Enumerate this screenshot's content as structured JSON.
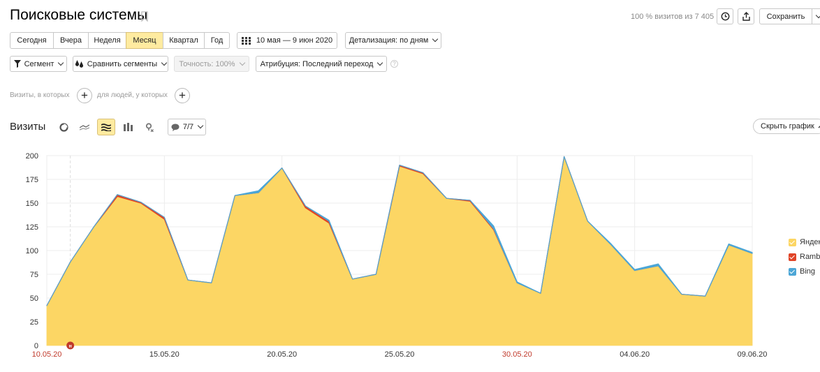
{
  "header": {
    "title": "Поисковые системы",
    "visits_info": "100 % визитов из 7 405",
    "save_label": "Сохранить"
  },
  "periods": [
    "Сегодня",
    "Вчера",
    "Неделя",
    "Месяц",
    "Квартал",
    "Год"
  ],
  "active_period": "Месяц",
  "date_range": "10 мая — 9 июн 2020",
  "detail": "Детализация: по дням",
  "filters": {
    "segment": "Сегмент",
    "compare": "Сравнить сегменты",
    "accuracy": "Точность: 100%",
    "attribution": "Атрибуция: Последний переход"
  },
  "conditions": {
    "visits_label": "Визиты, в которых",
    "people_label": "для людей, у которых"
  },
  "chart_section": {
    "title": "Визиты",
    "notes_label": "7/7",
    "hide_label": "Скрыть график"
  },
  "colors": {
    "yandex": "#fcd664",
    "rambler": "#e04427",
    "bing": "#4ca6d6",
    "active_bg": "#ffeba0",
    "holiday_red": "#c0392b"
  },
  "chart_data": {
    "type": "area",
    "stacked": true,
    "x": [
      "10.05.20",
      "11.05.20",
      "12.05.20",
      "13.05.20",
      "14.05.20",
      "15.05.20",
      "16.05.20",
      "17.05.20",
      "18.05.20",
      "19.05.20",
      "20.05.20",
      "21.05.20",
      "22.05.20",
      "23.05.20",
      "24.05.20",
      "25.05.20",
      "26.05.20",
      "27.05.20",
      "28.05.20",
      "29.05.20",
      "30.05.20",
      "31.05.20",
      "01.06.20",
      "02.06.20",
      "03.06.20",
      "04.06.20",
      "05.06.20",
      "06.06.20",
      "07.06.20",
      "08.06.20",
      "09.06.20"
    ],
    "x_tick_labels": [
      "10.05.20",
      "15.05.20",
      "20.05.20",
      "25.05.20",
      "30.05.20",
      "04.06.20",
      "09.06.20"
    ],
    "red_tick_labels": [
      "10.05.20",
      "30.05.20"
    ],
    "ylim": [
      0,
      200
    ],
    "yticks": [
      0,
      25,
      50,
      75,
      100,
      125,
      150,
      175,
      200
    ],
    "grid": true,
    "legend": "right",
    "annotation": "н",
    "series": [
      {
        "name": "Яндекс",
        "values": [
          42,
          88,
          125,
          157,
          150,
          133,
          69,
          66,
          158,
          161,
          187,
          145,
          129,
          70,
          75,
          189,
          181,
          155,
          152,
          122,
          66,
          55,
          199,
          131,
          106,
          79,
          84,
          54,
          52,
          106,
          97
        ]
      },
      {
        "name": "Rambler",
        "values": [
          0,
          0,
          0,
          2,
          1,
          2,
          0,
          0,
          0,
          0,
          0,
          2,
          2,
          0,
          0,
          1,
          1,
          0,
          1,
          1,
          0,
          0,
          0,
          0,
          0,
          0,
          0,
          0,
          0,
          0,
          0
        ]
      },
      {
        "name": "Bing",
        "values": [
          0,
          0,
          0,
          0,
          0,
          0,
          0,
          0,
          0,
          2,
          0,
          0,
          1,
          0,
          0,
          0,
          0,
          0,
          0,
          3,
          1,
          0,
          0,
          0,
          1,
          1,
          2,
          0,
          0,
          1,
          1
        ]
      }
    ]
  }
}
